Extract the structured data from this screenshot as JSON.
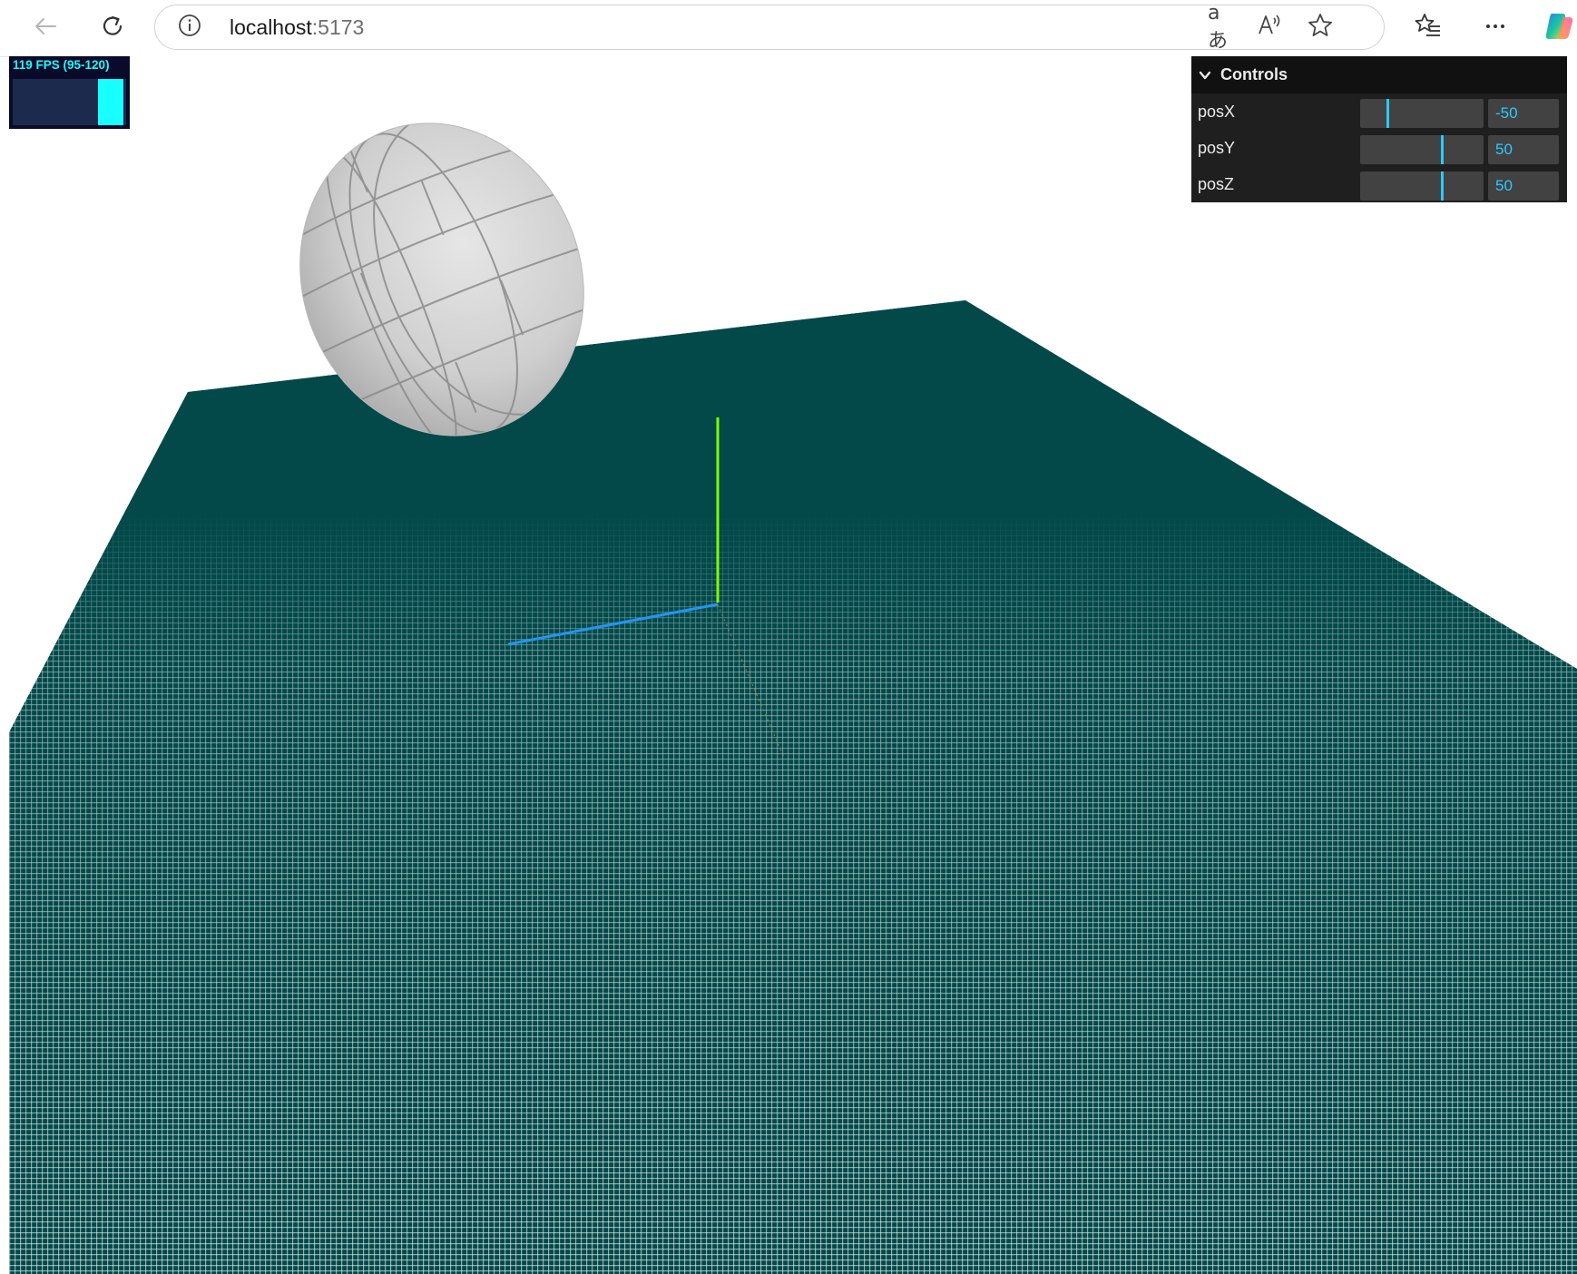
{
  "browser": {
    "url_host": "localhost",
    "url_port": ":5173",
    "icons": {
      "back": "back-arrow-icon",
      "reload": "reload-icon",
      "site_info": "info-icon",
      "translate": "translate-icon",
      "read_aloud": "read-aloud-icon",
      "favorite": "star-icon",
      "favorites": "favorites-list-icon",
      "more": "more-icon",
      "copilot": "copilot-icon"
    },
    "translate_glyph": "aあ",
    "read_aloud_glyph": "A"
  },
  "stats": {
    "text": "119 FPS (95-120)",
    "fps": 119,
    "min": 95,
    "max": 120,
    "color": "#18ffff",
    "background": "#0a0a2a"
  },
  "controls": {
    "title": "Controls",
    "items": [
      {
        "label": "posX",
        "value": "-50",
        "fraction": 0.22
      },
      {
        "label": "posY",
        "value": "50",
        "fraction": 0.67
      },
      {
        "label": "posZ",
        "value": "50",
        "fraction": 0.67
      }
    ],
    "accent": "#2cc9ff"
  },
  "scene": {
    "plane_color": "#03494a",
    "grid_line_color": "#ffffff",
    "sphere_color": "#c9c9c9",
    "axes": {
      "y_color": "#7fff00",
      "z_color": "#2196f3",
      "x_color": "#b07a3a"
    }
  }
}
